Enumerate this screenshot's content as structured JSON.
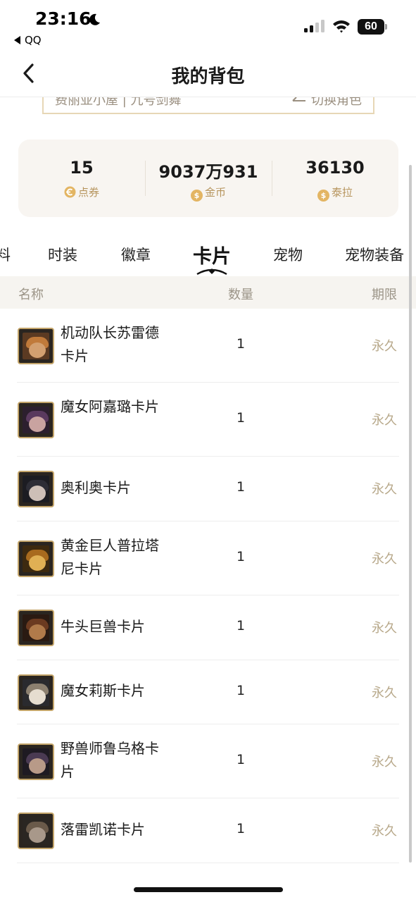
{
  "status_bar": {
    "time": "23:16",
    "back_app": "QQ",
    "battery": "60"
  },
  "nav": {
    "title": "我的背包"
  },
  "role_bar": {
    "role_name": "费丽亚小屋 | 九号剑舞",
    "switch_label": "切换角色"
  },
  "currencies": [
    {
      "value": "15",
      "label": "点券",
      "icon": "ticket-icon"
    },
    {
      "value": "9037万931",
      "label": "金币",
      "icon": "coin-icon"
    },
    {
      "value": "36130",
      "label": "泰拉",
      "icon": "coin-icon"
    }
  ],
  "tabs": [
    {
      "label": "料"
    },
    {
      "label": "时装"
    },
    {
      "label": "徽章"
    },
    {
      "label": "卡片",
      "active": true
    },
    {
      "label": "宠物"
    },
    {
      "label": "宠物装备"
    }
  ],
  "table_header": {
    "name": "名称",
    "quantity": "数量",
    "expiry": "期限"
  },
  "items": [
    {
      "name": "机动队长苏雷德卡片",
      "quantity": "1",
      "expiry": "永久",
      "icon": "card-portrait-icon"
    },
    {
      "name": "魔女阿嘉璐卡片",
      "quantity": "1",
      "expiry": "永久",
      "icon": "card-portrait-icon"
    },
    {
      "name": "奥利奥卡片",
      "quantity": "1",
      "expiry": "永久",
      "icon": "card-portrait-icon"
    },
    {
      "name": "黄金巨人普拉塔尼卡片",
      "quantity": "1",
      "expiry": "永久",
      "icon": "card-portrait-icon"
    },
    {
      "name": "牛头巨兽卡片",
      "quantity": "1",
      "expiry": "永久",
      "icon": "card-portrait-icon"
    },
    {
      "name": "魔女莉斯卡片",
      "quantity": "1",
      "expiry": "永久",
      "icon": "card-portrait-icon"
    },
    {
      "name": "野兽师鲁乌格卡片",
      "quantity": "1",
      "expiry": "永久",
      "icon": "card-portrait-icon"
    },
    {
      "name": "落雷凯诺卡片",
      "quantity": "1",
      "expiry": "永久",
      "icon": "card-portrait-icon"
    }
  ],
  "colors": {
    "accent_gold": "#c4a56a",
    "coin": "#e3b563",
    "panel_bg": "#f8f5f1",
    "muted_text": "#9c9588"
  }
}
